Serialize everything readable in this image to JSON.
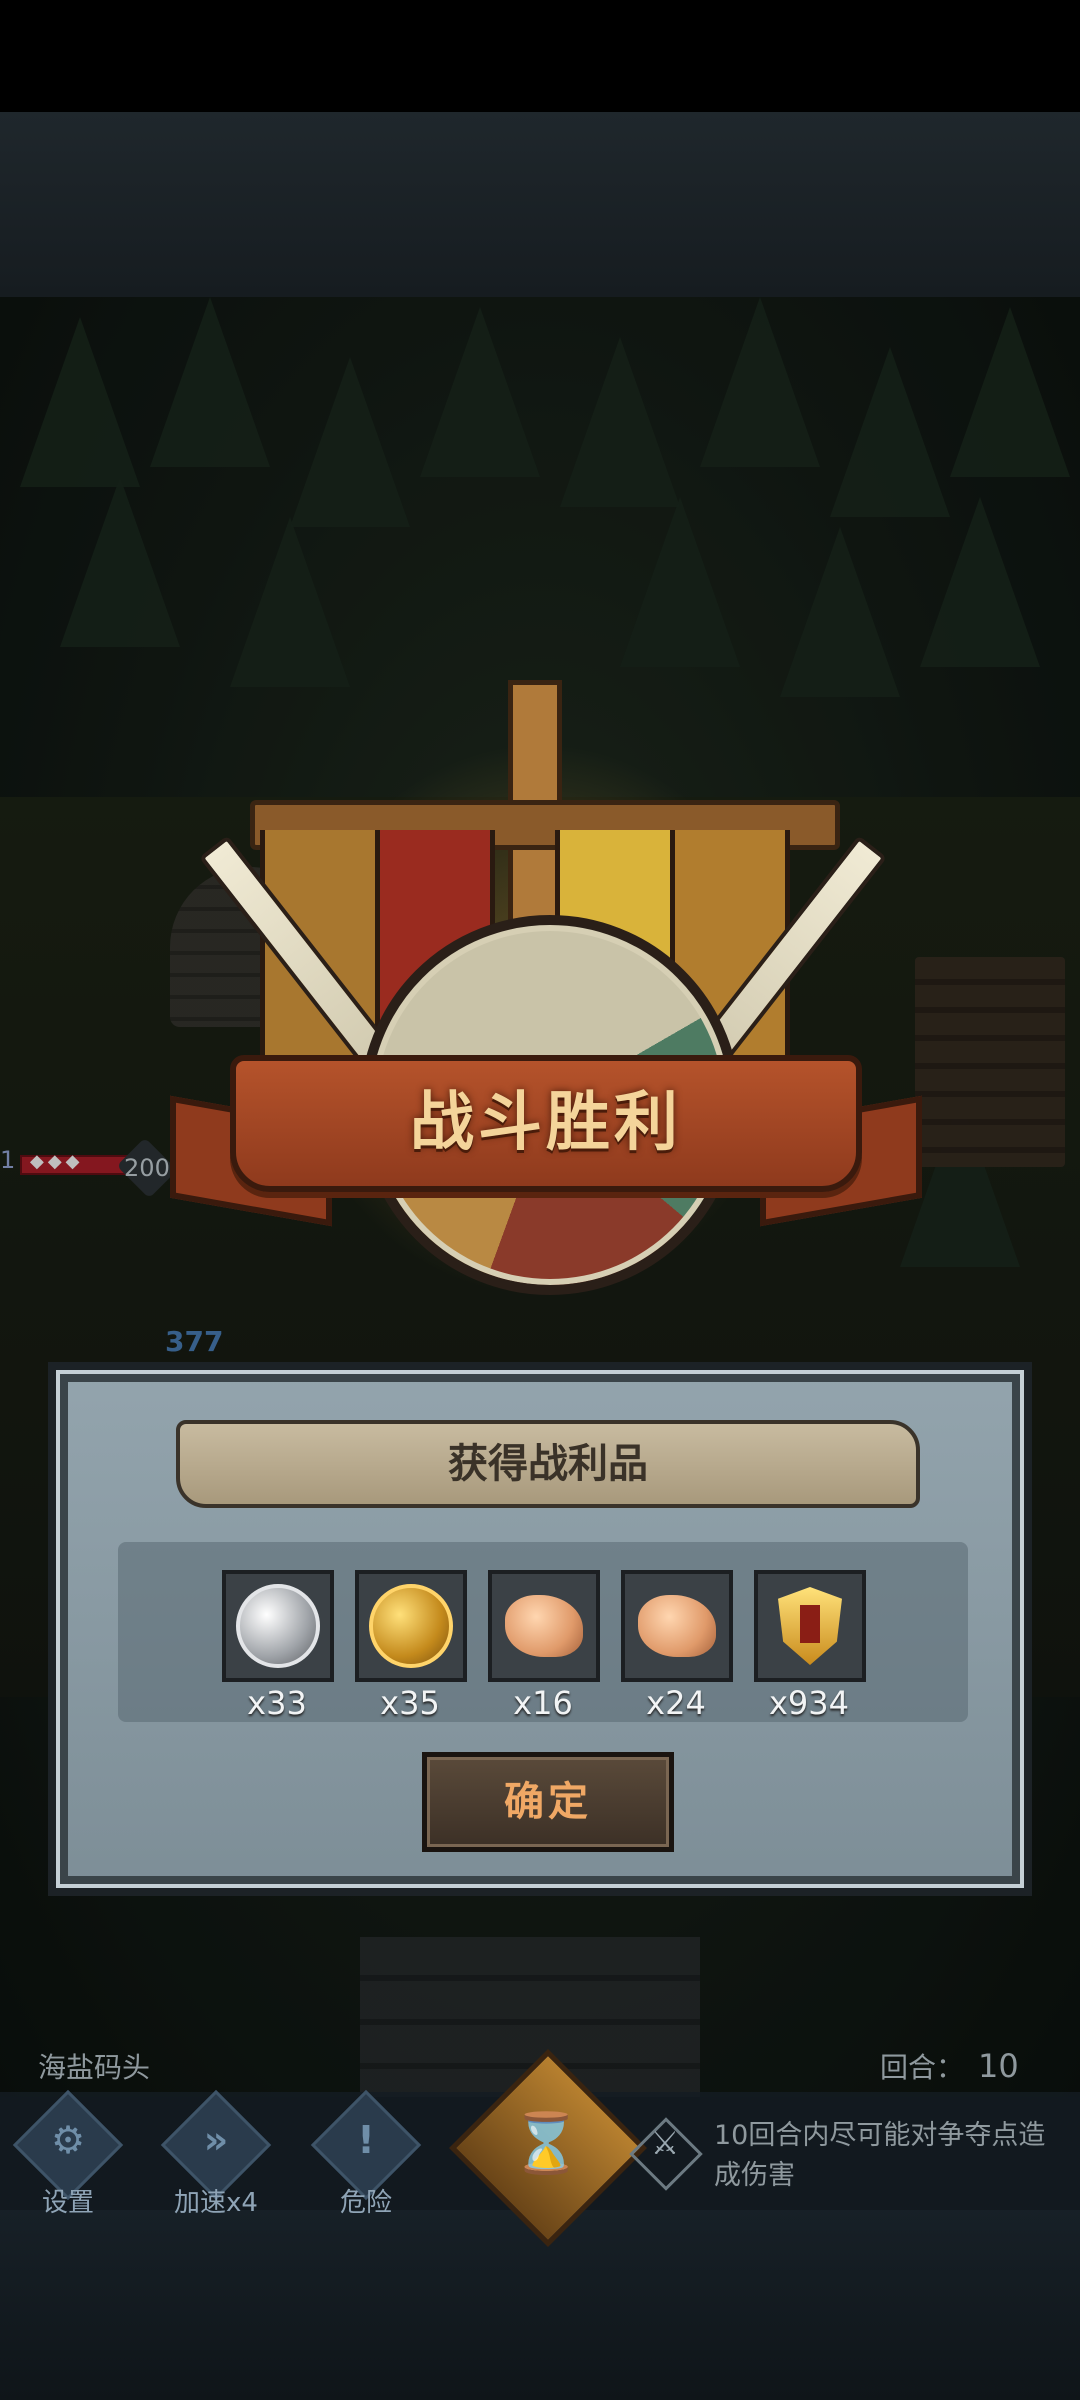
{
  "victory": {
    "title": "战斗胜利"
  },
  "loot_panel": {
    "header": "获得战利品",
    "items": [
      {
        "icon": "silver-coin-icon",
        "qty": "x33"
      },
      {
        "icon": "gold-coin-icon",
        "qty": "x35"
      },
      {
        "icon": "ore-icon",
        "qty": "x16"
      },
      {
        "icon": "ore-icon",
        "qty": "x24"
      },
      {
        "icon": "honor-badge-icon",
        "qty": "x934"
      }
    ],
    "confirm_label": "确定"
  },
  "scene": {
    "ally_level": "1",
    "hp_value": "200",
    "damage_number": "377"
  },
  "hud": {
    "location": "海盐码头",
    "round_label": "回合：",
    "round_value": "10",
    "settings_label": "设置",
    "speed_label": "加速x4",
    "danger_label": "危险",
    "tip_text": "10回合内尽可能对争夺点造成伤害"
  },
  "colors": {
    "banner_text": "#f4d49a",
    "confirm_text": "#f0a865",
    "panel_bg": "#8a9ba4"
  }
}
